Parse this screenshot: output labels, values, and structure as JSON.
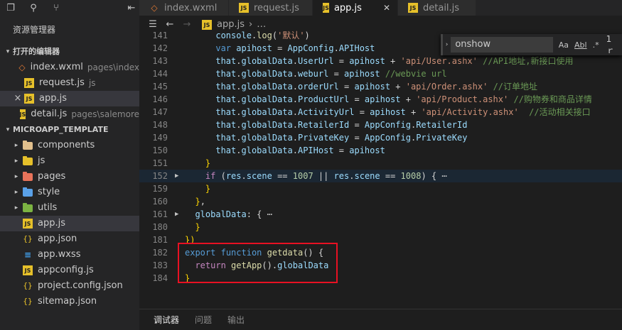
{
  "sidebar": {
    "toolbar_icons": [
      "files-icon",
      "search-icon",
      "source-control-icon",
      "split-icon"
    ],
    "title": "资源管理器",
    "open_editors": {
      "header": "打开的编辑器",
      "items": [
        {
          "name": "index.wxml",
          "path": "pages\\index",
          "icon": "wxml"
        },
        {
          "name": "request.js",
          "path": "js",
          "icon": "js"
        },
        {
          "name": "app.js",
          "path": "",
          "icon": "js",
          "selected": true,
          "close_glyph": "×"
        },
        {
          "name": "detail.js",
          "path": "pages\\salemore",
          "icon": "js"
        }
      ]
    },
    "project": {
      "header": "MICROAPP_TEMPLATE",
      "folders": [
        {
          "name": "components",
          "color": "#e2c08d"
        },
        {
          "name": "js",
          "color": "#e6c02a"
        },
        {
          "name": "pages",
          "color": "#e8735a"
        },
        {
          "name": "style",
          "color": "#5aa1e8"
        },
        {
          "name": "utils",
          "color": "#7cb342"
        }
      ],
      "files": [
        {
          "name": "app.js",
          "icon": "js",
          "selected": true
        },
        {
          "name": "app.json",
          "icon": "json"
        },
        {
          "name": "app.wxss",
          "icon": "css"
        },
        {
          "name": "appconfig.js",
          "icon": "js"
        },
        {
          "name": "project.config.json",
          "icon": "json"
        },
        {
          "name": "sitemap.json",
          "icon": "json"
        }
      ]
    }
  },
  "tabs": [
    {
      "label": "index.wxml",
      "icon": "wxml",
      "active": false
    },
    {
      "label": "request.js",
      "icon": "js",
      "active": false
    },
    {
      "label": "app.js",
      "icon": "js",
      "active": true,
      "close": "✕"
    },
    {
      "label": "detail.js",
      "icon": "js",
      "active": false
    }
  ],
  "breadcrumb": {
    "file": "app.js",
    "sep": "›",
    "rest": "…"
  },
  "find_widget": {
    "query": "onshow",
    "opt_case": "Aa",
    "opt_word": "Abl",
    "opt_regex": ".*",
    "result": "1 ｒ"
  },
  "editor": {
    "lines": [
      {
        "n": "141",
        "t": [
          [
            "pl",
            "      "
          ],
          [
            "var",
            "console"
          ],
          [
            "pl",
            "."
          ],
          [
            "fn",
            "log"
          ],
          [
            "pl",
            "("
          ],
          [
            "str",
            "'默认'"
          ],
          [
            "pl",
            ")"
          ]
        ]
      },
      {
        "n": "142",
        "t": [
          [
            "pl",
            "      "
          ],
          [
            "kw",
            "var"
          ],
          [
            "pl",
            " "
          ],
          [
            "var",
            "apihost"
          ],
          [
            "pl",
            " = "
          ],
          [
            "var",
            "AppConfig"
          ],
          [
            "pl",
            "."
          ],
          [
            "var",
            "APIHost"
          ]
        ]
      },
      {
        "n": "143",
        "t": [
          [
            "pl",
            "      "
          ],
          [
            "var",
            "that"
          ],
          [
            "pl",
            "."
          ],
          [
            "var",
            "globalData"
          ],
          [
            "pl",
            "."
          ],
          [
            "var",
            "UserUrl"
          ],
          [
            "pl",
            " = "
          ],
          [
            "var",
            "apihost"
          ],
          [
            "pl",
            " + "
          ],
          [
            "str",
            "'api/User.ashx'"
          ],
          [
            "pl",
            " "
          ],
          [
            "cm",
            "//API地址,新接口使用"
          ]
        ]
      },
      {
        "n": "144",
        "t": [
          [
            "pl",
            "      "
          ],
          [
            "var",
            "that"
          ],
          [
            "pl",
            "."
          ],
          [
            "var",
            "globalData"
          ],
          [
            "pl",
            "."
          ],
          [
            "var",
            "weburl"
          ],
          [
            "pl",
            " = "
          ],
          [
            "var",
            "apihost"
          ],
          [
            "pl",
            " "
          ],
          [
            "cm",
            "//webvie url"
          ]
        ]
      },
      {
        "n": "145",
        "t": [
          [
            "pl",
            "      "
          ],
          [
            "var",
            "that"
          ],
          [
            "pl",
            "."
          ],
          [
            "var",
            "globalData"
          ],
          [
            "pl",
            "."
          ],
          [
            "var",
            "orderUrl"
          ],
          [
            "pl",
            " = "
          ],
          [
            "var",
            "apihost"
          ],
          [
            "pl",
            " + "
          ],
          [
            "str",
            "'api/Order.ashx'"
          ],
          [
            "pl",
            " "
          ],
          [
            "cm",
            "//订单地址"
          ]
        ]
      },
      {
        "n": "146",
        "t": [
          [
            "pl",
            "      "
          ],
          [
            "var",
            "that"
          ],
          [
            "pl",
            "."
          ],
          [
            "var",
            "globalData"
          ],
          [
            "pl",
            "."
          ],
          [
            "var",
            "ProductUrl"
          ],
          [
            "pl",
            " = "
          ],
          [
            "var",
            "apihost"
          ],
          [
            "pl",
            " + "
          ],
          [
            "str",
            "'api/Product.ashx'"
          ],
          [
            "pl",
            " "
          ],
          [
            "cm",
            "//购物券和商品详情"
          ]
        ]
      },
      {
        "n": "147",
        "t": [
          [
            "pl",
            "      "
          ],
          [
            "var",
            "that"
          ],
          [
            "pl",
            "."
          ],
          [
            "var",
            "globalData"
          ],
          [
            "pl",
            "."
          ],
          [
            "var",
            "ActivityUrl"
          ],
          [
            "pl",
            " = "
          ],
          [
            "var",
            "apihost"
          ],
          [
            "pl",
            " + "
          ],
          [
            "str",
            "'api/Activity.ashx'"
          ],
          [
            "pl",
            "  "
          ],
          [
            "cm",
            "//活动相关接口"
          ]
        ]
      },
      {
        "n": "148",
        "t": [
          [
            "pl",
            "      "
          ],
          [
            "var",
            "that"
          ],
          [
            "pl",
            "."
          ],
          [
            "var",
            "globalData"
          ],
          [
            "pl",
            "."
          ],
          [
            "var",
            "RetailerId"
          ],
          [
            "pl",
            " = "
          ],
          [
            "var",
            "AppConfig"
          ],
          [
            "pl",
            "."
          ],
          [
            "var",
            "RetailerId"
          ]
        ]
      },
      {
        "n": "149",
        "t": [
          [
            "pl",
            "      "
          ],
          [
            "var",
            "that"
          ],
          [
            "pl",
            "."
          ],
          [
            "var",
            "globalData"
          ],
          [
            "pl",
            "."
          ],
          [
            "var",
            "PrivateKey"
          ],
          [
            "pl",
            " = "
          ],
          [
            "var",
            "AppConfig"
          ],
          [
            "pl",
            "."
          ],
          [
            "var",
            "PrivateKey"
          ]
        ]
      },
      {
        "n": "150",
        "t": [
          [
            "pl",
            "      "
          ],
          [
            "var",
            "that"
          ],
          [
            "pl",
            "."
          ],
          [
            "var",
            "globalData"
          ],
          [
            "pl",
            "."
          ],
          [
            "var",
            "APIHost"
          ],
          [
            "pl",
            " = "
          ],
          [
            "var",
            "apihost"
          ]
        ]
      },
      {
        "n": "151",
        "t": [
          [
            "pl",
            "    "
          ],
          [
            "brk",
            "}"
          ]
        ]
      },
      {
        "n": "152",
        "fold": true,
        "hl": true,
        "t": [
          [
            "pl",
            "    "
          ],
          [
            "ctrl",
            "if"
          ],
          [
            "pl",
            " ("
          ],
          [
            "var",
            "res"
          ],
          [
            "pl",
            "."
          ],
          [
            "var",
            "scene"
          ],
          [
            "pl",
            " == "
          ],
          [
            "num",
            "1007"
          ],
          [
            "pl",
            " || "
          ],
          [
            "var",
            "res"
          ],
          [
            "pl",
            "."
          ],
          [
            "var",
            "scene"
          ],
          [
            "pl",
            " == "
          ],
          [
            "num",
            "1008"
          ],
          [
            "pl",
            ") { ⋯"
          ]
        ]
      },
      {
        "n": "159",
        "t": [
          [
            "pl",
            "    "
          ],
          [
            "brk",
            "}"
          ]
        ]
      },
      {
        "n": "160",
        "t": [
          [
            "pl",
            "  "
          ],
          [
            "brk",
            "}"
          ],
          [
            "pl",
            ","
          ]
        ]
      },
      {
        "n": "161",
        "fold": true,
        "t": [
          [
            "pl",
            "  "
          ],
          [
            "var",
            "globalData"
          ],
          [
            "pl",
            ": { ⋯"
          ]
        ]
      },
      {
        "n": "180",
        "t": [
          [
            "pl",
            "  "
          ],
          [
            "brk",
            "}"
          ]
        ]
      },
      {
        "n": "181",
        "t": [
          [
            "brk",
            "})"
          ]
        ]
      },
      {
        "n": "182",
        "t": [
          [
            "kw",
            "export"
          ],
          [
            "pl",
            " "
          ],
          [
            "kw",
            "function"
          ],
          [
            "pl",
            " "
          ],
          [
            "fn",
            "getdata"
          ],
          [
            "pl",
            "() {"
          ]
        ]
      },
      {
        "n": "183",
        "t": [
          [
            "pl",
            "  "
          ],
          [
            "ctrl",
            "return"
          ],
          [
            "pl",
            " "
          ],
          [
            "fn",
            "getApp"
          ],
          [
            "pl",
            "()."
          ],
          [
            "var",
            "globalData"
          ]
        ]
      },
      {
        "n": "184",
        "t": [
          [
            "brk",
            "}"
          ]
        ]
      }
    ]
  },
  "panel": {
    "tabs": [
      "调试器",
      "问题",
      "输出"
    ],
    "active": 0
  },
  "colors": {
    "annotation": "#e81123",
    "accent_js": "#e6c02a"
  }
}
